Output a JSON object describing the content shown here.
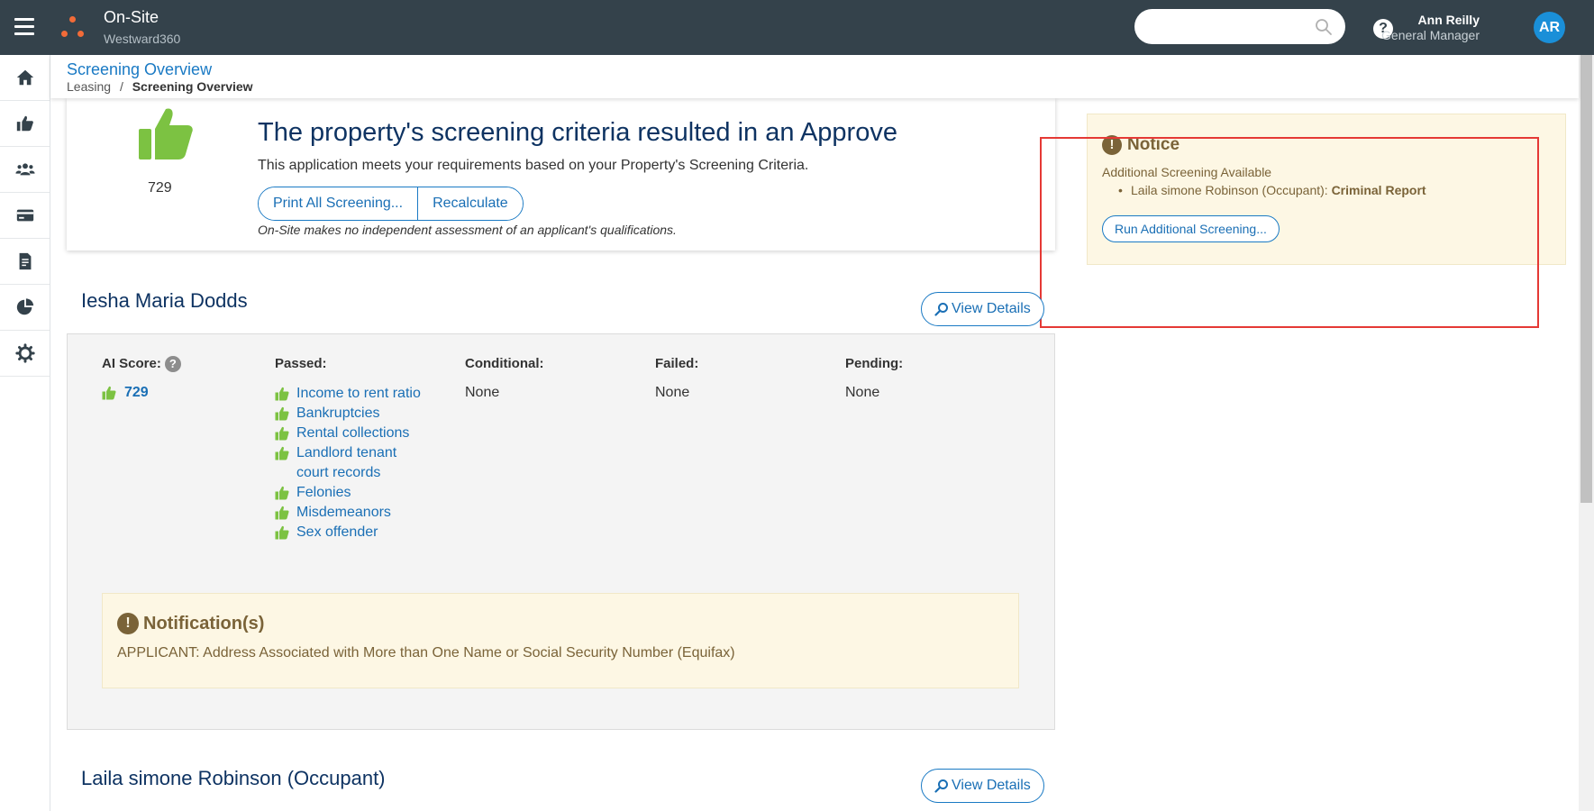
{
  "header": {
    "app_title": "On-Site",
    "app_subtitle": "Westward360",
    "search_placeholder": "",
    "user_name": "Ann Reilly",
    "user_role": "General Manager",
    "avatar_initials": "AR"
  },
  "nav": {
    "items": [
      "home-icon",
      "thumbs-up-icon",
      "users-icon",
      "credit-card-icon",
      "report-icon",
      "pie-chart-icon",
      "gear-icon"
    ]
  },
  "page": {
    "title": "Screening Overview",
    "breadcrumb_parent": "Leasing",
    "breadcrumb_separator": "/",
    "breadcrumb_current": "Screening Overview"
  },
  "decision": {
    "score": "729",
    "title": "The property's screening criteria resulted in an Approve",
    "description": "This application meets your requirements based on your Property's Screening Criteria.",
    "print_button": "Print All Screening...",
    "recalculate_button": "Recalculate",
    "disclaimer": "On-Site makes no independent assessment of an applicant's qualifications."
  },
  "notice": {
    "icon": "!",
    "title": "Notice",
    "subtitle": "Additional Screening Available",
    "item_person": "Laila simone Robinson (Occupant):",
    "item_report": "Criminal Report",
    "run_button": "Run Additional Screening..."
  },
  "applicant": {
    "name": "Iesha Maria Dodds",
    "view_details": "View Details",
    "ai_score_label": "AI Score:",
    "ai_help": "?",
    "ai_score": "729",
    "passed_label": "Passed:",
    "conditional_label": "Conditional:",
    "failed_label": "Failed:",
    "pending_label": "Pending:",
    "passed": [
      "Income to rent ratio",
      "Bankruptcies",
      "Rental collections",
      "Landlord tenant court records",
      "Felonies",
      "Misdemeanors",
      "Sex offender"
    ],
    "conditional": "None",
    "failed": "None",
    "pending": "None",
    "notification_icon": "!",
    "notification_title": "Notification(s)",
    "notification_text": "APPLICANT: Address Associated with More than One Name or Social Security Number (Equifax)"
  },
  "occupant": {
    "name": "Laila simone Robinson (Occupant)",
    "view_details": "View Details"
  },
  "colors": {
    "topbar": "#34424b",
    "accent_blue": "#1a7ac4",
    "approve_green": "#7cc242",
    "notice_bg": "#fdf7e4",
    "notice_text": "#7a6338",
    "highlight_red": "#e53935"
  }
}
